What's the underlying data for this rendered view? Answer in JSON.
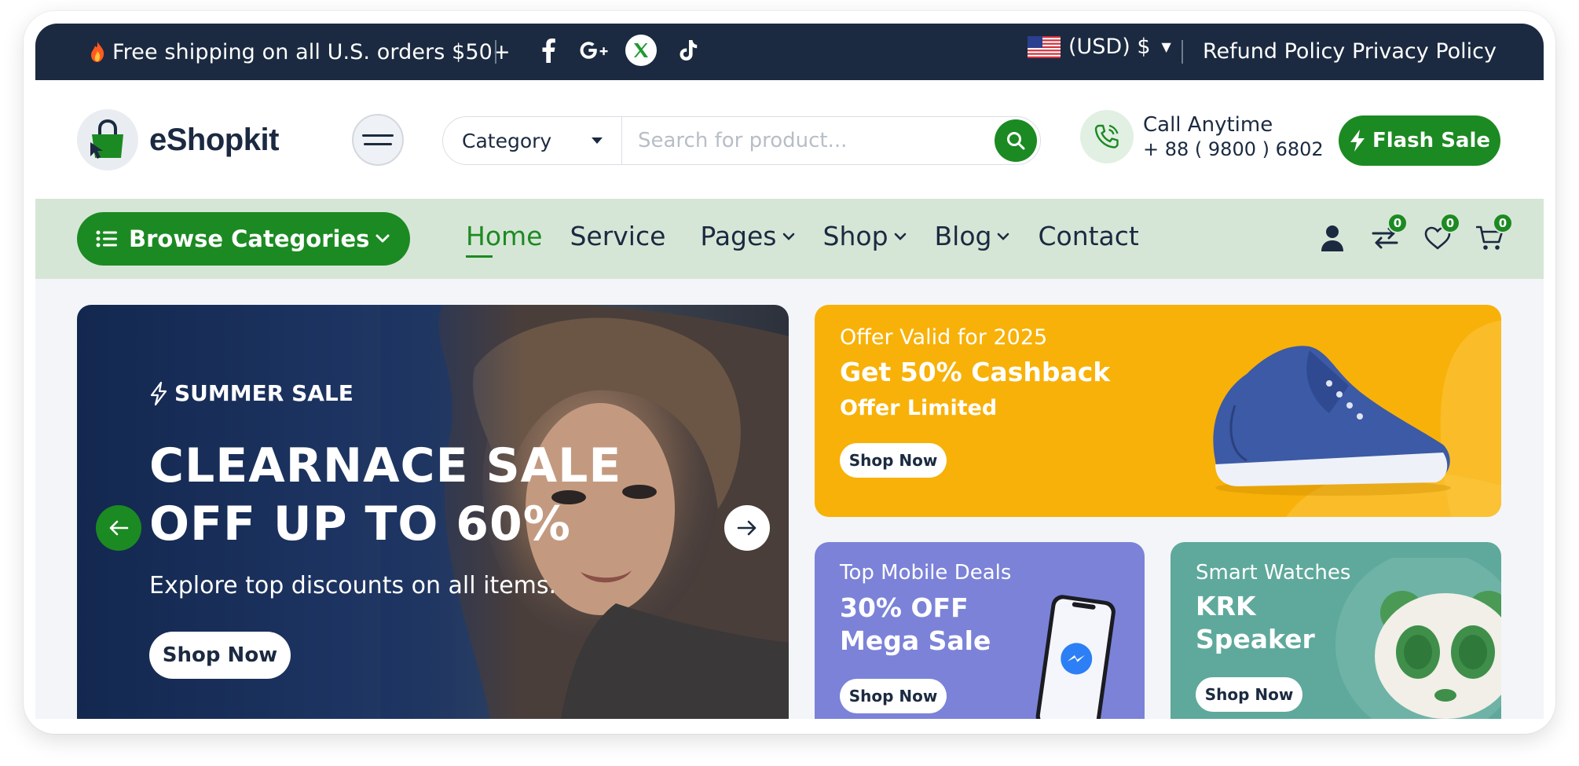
{
  "topbar": {
    "shipping_text": "Free shipping on all U.S. orders $50+",
    "socials": [
      "facebook-icon",
      "google-plus-icon",
      "x-icon",
      "tiktok-icon"
    ],
    "currency": "(USD) $",
    "refund_policy": "Refund Policy",
    "privacy_policy": "Privacy Policy"
  },
  "header": {
    "logo_text": "eShopkit",
    "search": {
      "category": "Category",
      "placeholder": "Search for product..."
    },
    "call": {
      "label": "Call Anytime",
      "number": "+ 88 ( 9800 ) 6802"
    },
    "flash_sale": "Flash Sale"
  },
  "nav": {
    "browse": "Browse Categories",
    "links": [
      "Home",
      "Service",
      "Pages",
      "Shop",
      "Blog",
      "Contact"
    ],
    "compare_count": "0",
    "wishlist_count": "0",
    "cart_count": "0"
  },
  "hero": {
    "kicker": "SUMMER SALE",
    "headline_1": "CLEARNACE SALE",
    "headline_2": "OFF UP TO 60%",
    "subtitle": "Explore top discounts on all items.",
    "button": "Shop Now"
  },
  "promos": [
    {
      "line1": "Offer Valid for 2025",
      "line2": "Get 50%  Cashback",
      "line3": "Offer Limited",
      "button": "Shop Now"
    },
    {
      "line1": "Top Mobile Deals",
      "line2": "30% OFF",
      "line3": "Mega Sale",
      "button": "Shop Now"
    },
    {
      "line1": "Smart Watches",
      "line2": "KRK",
      "line3": "Speaker",
      "button": "Shop Now"
    }
  ],
  "colors": {
    "brand_green": "#1c8a22",
    "topbar_bg": "#1b2a40",
    "nav_bg": "#d6e6d6",
    "promo_yellow": "#f8b108",
    "promo_purple": "#7b82d8",
    "promo_teal": "#5ea99b"
  }
}
